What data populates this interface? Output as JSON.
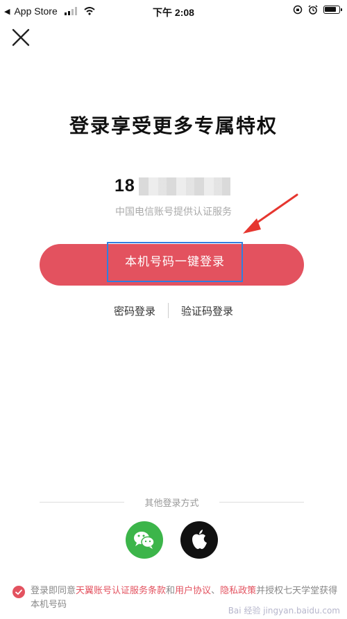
{
  "status_bar": {
    "back_app": "App Store",
    "time": "下午 2:08"
  },
  "login": {
    "title": "登录享受更多专属特权",
    "phone_prefix": "18",
    "carrier_note": "中国电信账号提供认证服务",
    "one_click_label": "本机号码一键登录",
    "password_login": "密码登录",
    "code_login": "验证码登录"
  },
  "other": {
    "label": "其他登录方式"
  },
  "agreement": {
    "prefix": "登录即同意",
    "terms": "天翼账号认证服务条款",
    "and": "和",
    "user_agreement": "用户协议",
    "sep": "、",
    "privacy": "隐私政策",
    "suffix": "并授权七天学堂获得本机号码"
  },
  "watermark": "Bai 经验 jingyan.baidu.com",
  "colors": {
    "primary": "#e3525f",
    "wechat": "#3cb54a",
    "highlight": "#2f7fe0"
  },
  "icons": [
    "close-icon",
    "wechat-icon",
    "apple-icon",
    "check-icon",
    "arrow-annotation"
  ]
}
